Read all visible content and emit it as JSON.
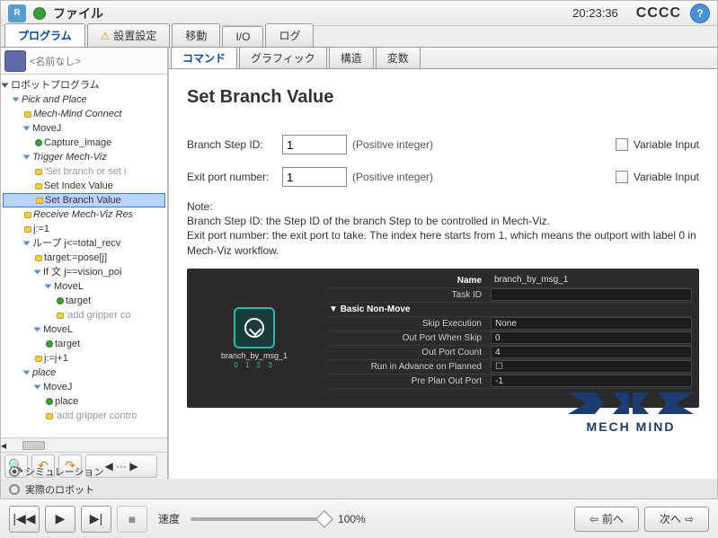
{
  "top": {
    "file": "ファイル",
    "time": "20:23:36",
    "cccc": "CCCC"
  },
  "main_tabs": [
    "プログラム",
    "設置設定",
    "移動",
    "I/O",
    "ログ"
  ],
  "left": {
    "filename": "<名前なし>",
    "tree": [
      {
        "t": "ロボットプログラム",
        "l": 0,
        "k": "tb"
      },
      {
        "t": "Pick and Place",
        "l": 1,
        "k": "tc",
        "i": 1
      },
      {
        "t": "Mech-Mind Connect",
        "l": 2,
        "k": "y",
        "i": 1
      },
      {
        "t": "MoveJ",
        "l": 2,
        "k": "tc"
      },
      {
        "t": "Capture_image",
        "l": 3,
        "k": "g"
      },
      {
        "t": "Trigger Mech-Viz",
        "l": 2,
        "k": "tc",
        "i": 1
      },
      {
        "t": "'Set branch or set i",
        "l": 3,
        "k": "y",
        "grey": 1
      },
      {
        "t": "Set Index Value",
        "l": 3,
        "k": "y"
      },
      {
        "t": "Set Branch Value",
        "l": 3,
        "k": "y",
        "sel": 1
      },
      {
        "t": "Receive Mech-Viz Res",
        "l": 2,
        "k": "y",
        "i": 1
      },
      {
        "t": "j:=1",
        "l": 2,
        "k": "y"
      },
      {
        "t": "ループ j<=total_recv",
        "l": 2,
        "k": "tc"
      },
      {
        "t": "target:=pose[j]",
        "l": 3,
        "k": "y"
      },
      {
        "t": "If 文 j==vision_poi",
        "l": 3,
        "k": "tc"
      },
      {
        "t": "MoveL",
        "l": 4,
        "k": "tc"
      },
      {
        "t": "target",
        "l": 5,
        "k": "g"
      },
      {
        "t": "'add gripper co",
        "l": 5,
        "k": "y",
        "grey": 1
      },
      {
        "t": "MoveL",
        "l": 3,
        "k": "tc"
      },
      {
        "t": "target",
        "l": 4,
        "k": "g"
      },
      {
        "t": "j:=j+1",
        "l": 3,
        "k": "y"
      },
      {
        "t": "place",
        "l": 2,
        "k": "tc",
        "i": 1
      },
      {
        "t": "MoveJ",
        "l": 3,
        "k": "tc"
      },
      {
        "t": "place",
        "l": 4,
        "k": "g"
      },
      {
        "t": "'add gripper contro",
        "l": 4,
        "k": "y",
        "grey": 1
      }
    ],
    "sim": "シミュレーション",
    "real": "実際のロボット"
  },
  "cmd_tabs": [
    "コマンド",
    "グラフィック",
    "構造",
    "変数"
  ],
  "content": {
    "title": "Set Branch Value",
    "branch_label": "Branch Step ID:",
    "branch_value": "1",
    "exit_label": "Exit port number:",
    "exit_value": "1",
    "pos_int": "(Positive integer)",
    "var_input": "Variable Input",
    "note_hdr": "Note:",
    "note1": "Branch Step ID: the Step ID of the branch Step to be controlled in Mech-Viz.",
    "note2": "Exit port number: the exit port to take. The index here starts from 1, which means the outport with label 0 in Mech-Viz workflow.",
    "props": {
      "name_k": "Name",
      "name_v": "branch_by_msg_1",
      "task_k": "Task ID",
      "task_v": "",
      "grp": "Basic Non-Move",
      "skip_k": "Skip Execution",
      "skip_v": "None",
      "owhen_k": "Out Port When Skip",
      "owhen_v": "0",
      "ocount_k": "Out Port Count",
      "ocount_v": "4",
      "run_k": "Run in Advance on Planned",
      "run_v": "",
      "preplan_k": "Pre Plan Out Port",
      "preplan_v": "-1"
    },
    "node_label": "branch_by_msg_1",
    "logo": "MECH MIND"
  },
  "bottom": {
    "speed": "速度",
    "pct": "100%",
    "prev": "前へ",
    "next": "次へ"
  }
}
